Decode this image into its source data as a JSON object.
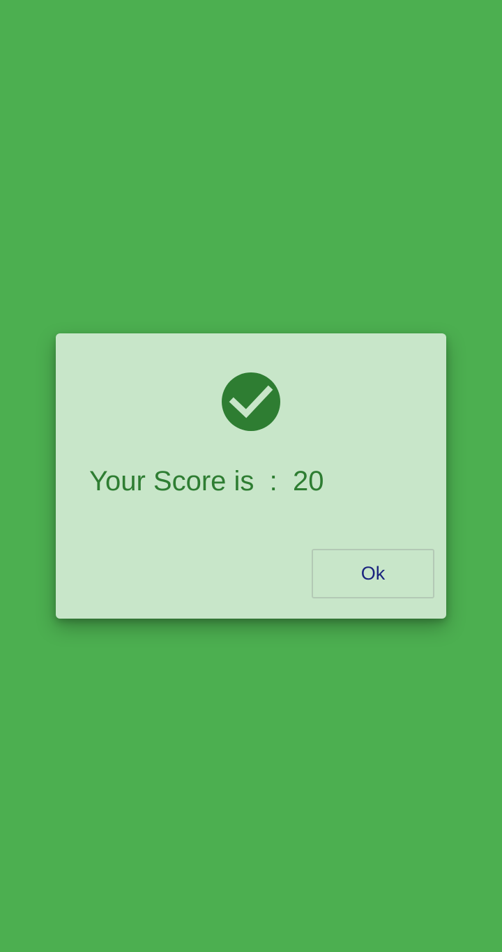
{
  "colors": {
    "background": "#4caf50",
    "dialog_background": "#c8e6c9",
    "primary_dark": "#2e7d32",
    "check_mark": "#c8e6c9",
    "button_text": "#1a237e"
  },
  "dialog": {
    "icon": "check-circle-icon",
    "message": "Your Score is  :  20",
    "ok_label": "Ok"
  }
}
